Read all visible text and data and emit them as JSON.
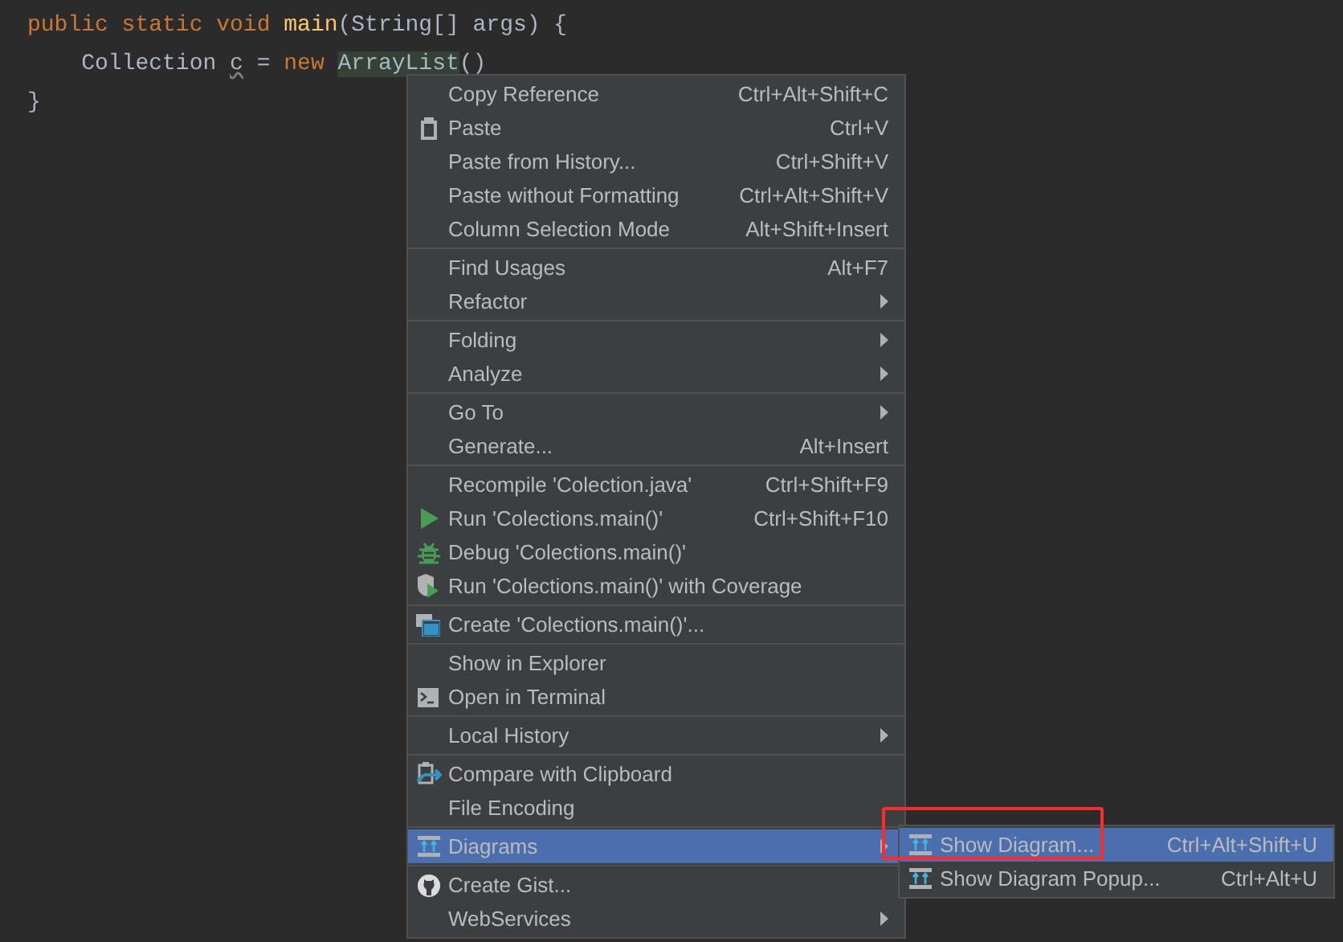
{
  "editor": {
    "lines": [
      {
        "tokens": [
          {
            "kind": "keyword",
            "text": "public static void "
          },
          {
            "kind": "method",
            "text": "main"
          },
          {
            "kind": "plain",
            "text": "(String[] args) {"
          }
        ]
      },
      {
        "tokens": [
          {
            "kind": "plain",
            "text": "    Collection "
          },
          {
            "kind": "warn",
            "text": "c"
          },
          {
            "kind": "plain",
            "text": " = "
          },
          {
            "kind": "keyword",
            "text": "new "
          },
          {
            "kind": "match",
            "text": "ArrayList"
          },
          {
            "kind": "plain",
            "text": "()"
          }
        ]
      },
      {
        "tokens": [
          {
            "kind": "plain",
            "text": "}"
          }
        ]
      }
    ]
  },
  "context_menu": {
    "groups": [
      [
        {
          "label": "Copy Reference",
          "shortcut": "Ctrl+Alt+Shift+C"
        },
        {
          "label": "Paste",
          "shortcut": "Ctrl+V",
          "kind": "clipboard"
        },
        {
          "label": "Paste from History...",
          "shortcut": "Ctrl+Shift+V"
        },
        {
          "label": "Paste without Formatting",
          "shortcut": "Ctrl+Alt+Shift+V"
        },
        {
          "label": "Column Selection Mode",
          "shortcut": "Alt+Shift+Insert"
        }
      ],
      [
        {
          "label": "Find Usages",
          "shortcut": "Alt+F7"
        },
        {
          "label": "Refactor",
          "submenu": true
        }
      ],
      [
        {
          "label": "Folding",
          "submenu": true
        },
        {
          "label": "Analyze",
          "submenu": true
        }
      ],
      [
        {
          "label": "Go To",
          "submenu": true
        },
        {
          "label": "Generate...",
          "shortcut": "Alt+Insert"
        }
      ],
      [
        {
          "label": "Recompile 'Colection.java'",
          "shortcut": "Ctrl+Shift+F9"
        },
        {
          "label": "Run 'Colections.main()'",
          "shortcut": "Ctrl+Shift+F10",
          "kind": "run"
        },
        {
          "label": "Debug 'Colections.main()'",
          "kind": "debug"
        },
        {
          "label": "Run 'Colections.main()' with Coverage",
          "kind": "coverage"
        }
      ],
      [
        {
          "label": "Create 'Colections.main()'...",
          "kind": "create"
        }
      ],
      [
        {
          "label": "Show in Explorer"
        },
        {
          "label": "Open in Terminal",
          "kind": "terminal"
        }
      ],
      [
        {
          "label": "Local History",
          "submenu": true
        }
      ],
      [
        {
          "label": "Compare with Clipboard",
          "kind": "compare"
        },
        {
          "label": "File Encoding"
        }
      ],
      [
        {
          "label": "Diagrams",
          "submenu": true,
          "kind": "diagram",
          "selected": true
        }
      ],
      [
        {
          "label": "Create Gist...",
          "kind": "github"
        },
        {
          "label": "WebServices",
          "submenu": true
        }
      ]
    ]
  },
  "submenu": {
    "items": [
      {
        "label": "Show Diagram...",
        "shortcut": "Ctrl+Alt+Shift+U",
        "kind": "diagram",
        "selected": true,
        "highlighted": true
      },
      {
        "label": "Show Diagram Popup...",
        "shortcut": "Ctrl+Alt+U",
        "kind": "diagram",
        "selected": false,
        "highlighted": false
      }
    ]
  }
}
